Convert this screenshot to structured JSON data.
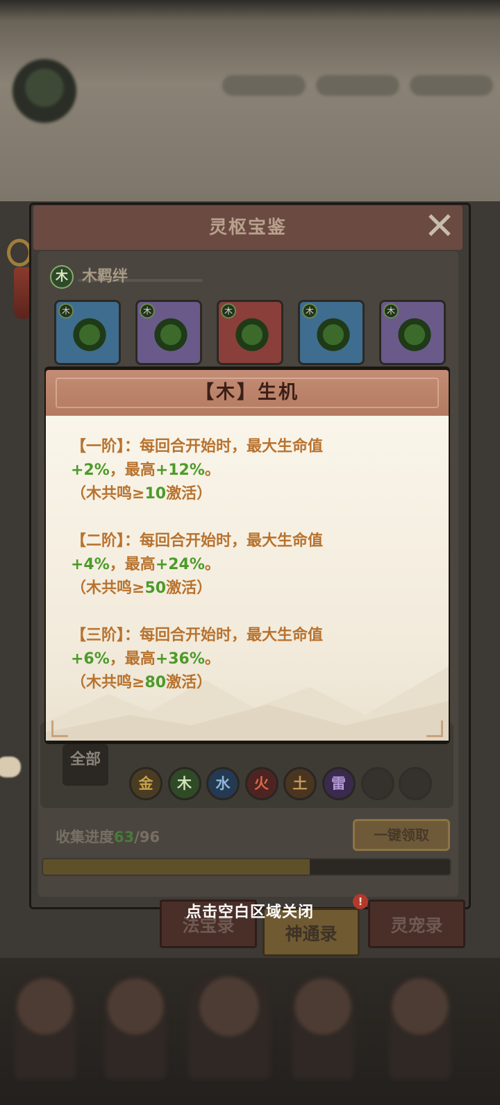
{
  "panel": {
    "title": "灵枢宝鉴",
    "close_glyph": "✕",
    "bond": {
      "icon_text": "木",
      "label": "木羁绊"
    },
    "cards": [
      {
        "badge": "木",
        "frame_color": "#3f6d8f"
      },
      {
        "badge": "木",
        "frame_color": "#6a5a8a"
      },
      {
        "badge": "木",
        "frame_color": "#8a3f3a"
      },
      {
        "badge": "木",
        "frame_color": "#3f6d8f"
      },
      {
        "badge": "木",
        "frame_color": "#6a5a8a"
      }
    ],
    "filter": {
      "all_label": "全部",
      "elements": [
        {
          "label": "金",
          "bg": "#4a3c22",
          "color": "#c9a24a"
        },
        {
          "label": "木",
          "bg": "#2f4a26",
          "color": "#cfe3b8"
        },
        {
          "label": "水",
          "bg": "#243a52",
          "color": "#8db8d8"
        },
        {
          "label": "火",
          "bg": "#4e2422",
          "color": "#d86a4a"
        },
        {
          "label": "土",
          "bg": "#4a3620",
          "color": "#c99a5a"
        },
        {
          "label": "雷",
          "bg": "#3a2a4e",
          "color": "#b59ad8"
        }
      ]
    },
    "progress": {
      "label": "收集进度",
      "current": "63",
      "separator": "/",
      "total": "96",
      "fraction": 0.656
    },
    "claim_button": "一键领取"
  },
  "tabs": {
    "fabao": "法宝录",
    "shentong": "神通录",
    "lingchong": "灵宠录",
    "alert": "!"
  },
  "popup": {
    "title": "【木】生机",
    "tiers": [
      {
        "head": "【一阶】：每回合开始时，最大生命值",
        "bonus": "+2%",
        "mid": "，最高",
        "max": "+12%",
        "end": "。",
        "cond_pre": "（木共鸣≥",
        "cond_num": "10",
        "cond_post": "激活）"
      },
      {
        "head": "【二阶】：每回合开始时，最大生命值",
        "bonus": "+4%",
        "mid": "，最高",
        "max": "+24%",
        "end": "。",
        "cond_pre": "（木共鸣≥",
        "cond_num": "50",
        "cond_post": "激活）"
      },
      {
        "head": "【三阶】：每回合开始时，最大生命值",
        "bonus": "+6%",
        "mid": "，最高",
        "max": "+36%",
        "end": "。",
        "cond_pre": "（木共鸣≥",
        "cond_num": "80",
        "cond_post": "激活）"
      }
    ]
  },
  "close_hint": "点击空白区域关闭"
}
